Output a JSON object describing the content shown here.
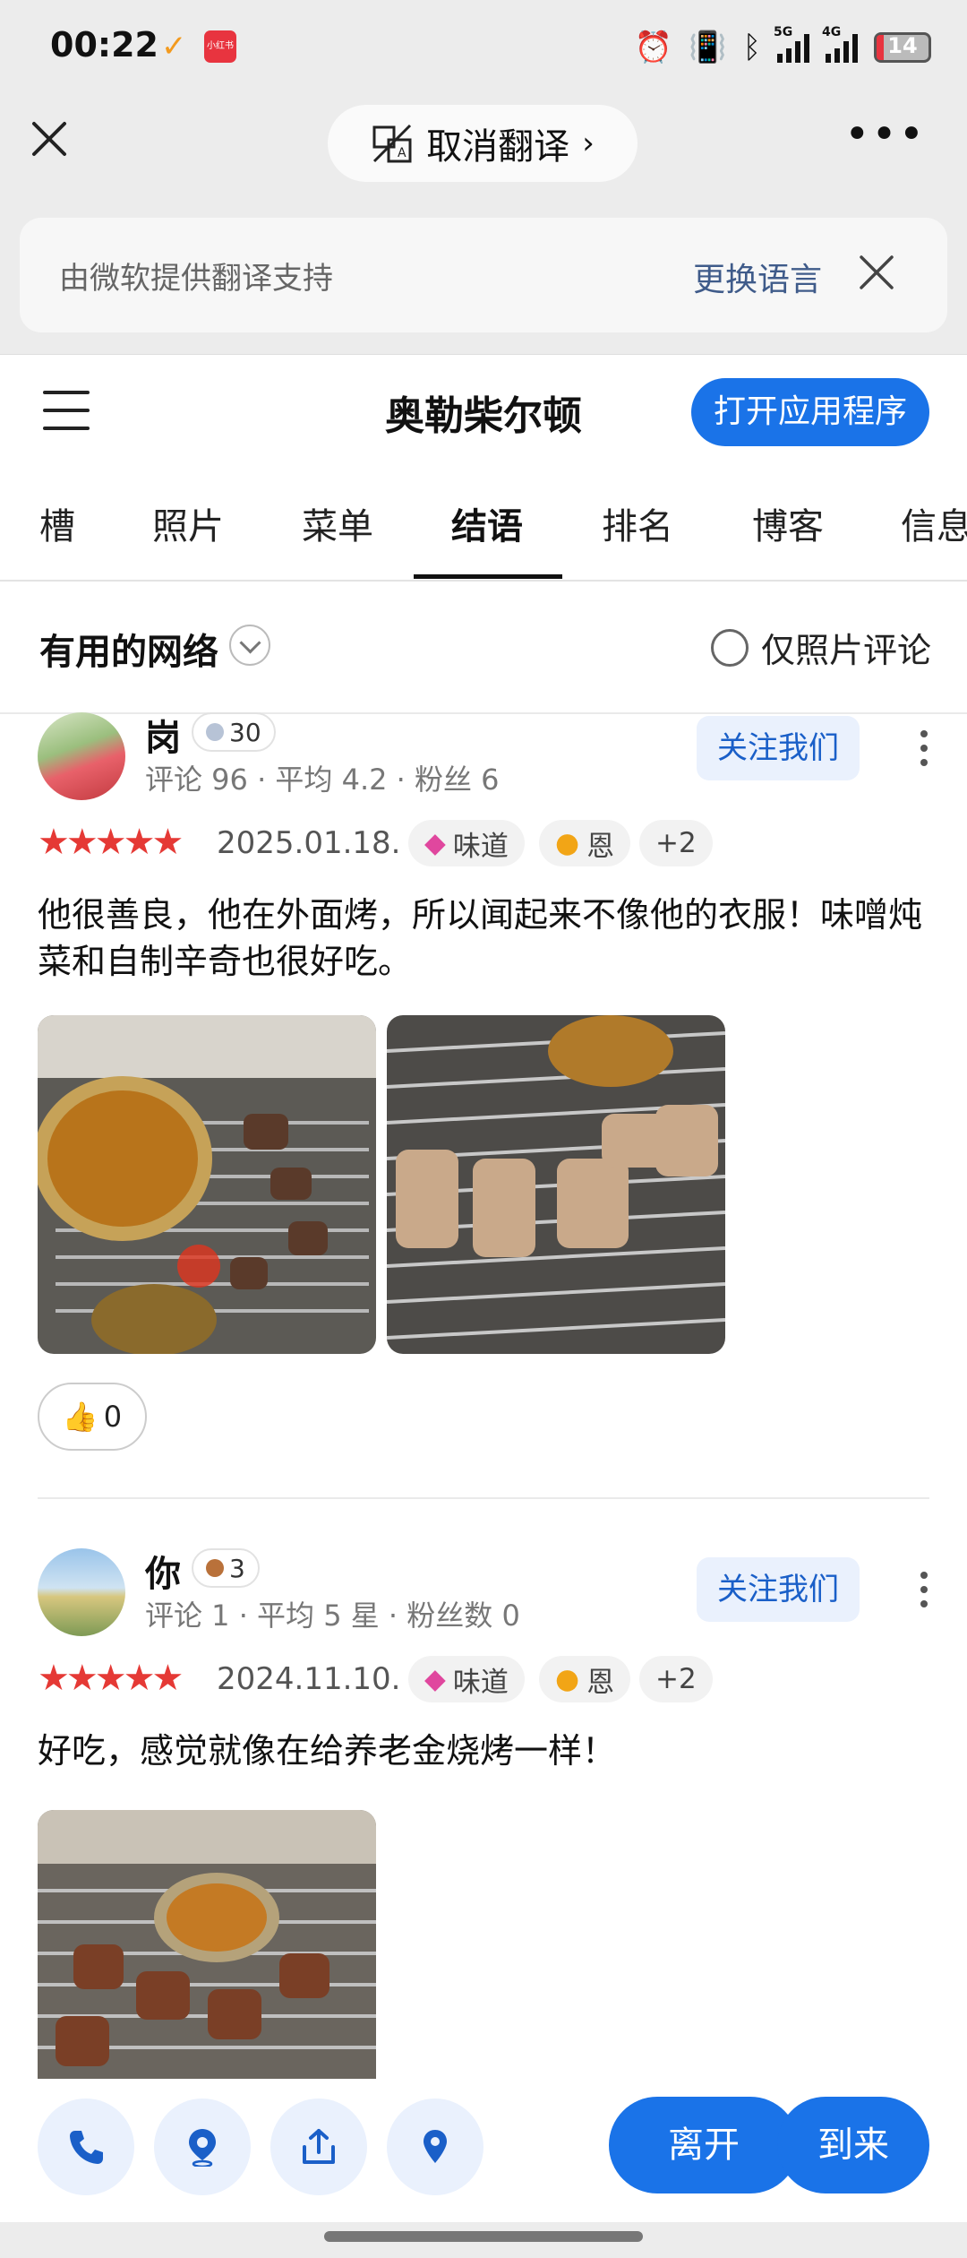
{
  "status_bar": {
    "time": "00:22",
    "mini_app_label": "小红书",
    "network_1": "5G",
    "network_2": "4G",
    "battery": "14"
  },
  "translate_bar": {
    "cancel_label": "取消翻译",
    "provider_text": "由微软提供翻译支持",
    "change_language": "更换语言"
  },
  "header": {
    "title": "奥勒柴尔顿",
    "open_app": "打开应用程序"
  },
  "tabs": [
    {
      "label": "槽"
    },
    {
      "label": "照片"
    },
    {
      "label": "菜单"
    },
    {
      "label": "结语",
      "active": true
    },
    {
      "label": "排名"
    },
    {
      "label": "博客"
    },
    {
      "label": "信息"
    }
  ],
  "filter": {
    "sort": "有用的网络",
    "photo_only": "仅照片评论"
  },
  "reviews": [
    {
      "name": "岗",
      "level": "30",
      "meta": "评论 96 · 平均 4.2 · 粉丝 6",
      "follow": "关注我们",
      "stars": "★★★★★",
      "date": "2025.01.18.",
      "chips": [
        "味道",
        "恩",
        "+2"
      ],
      "text": "他很善良，他在外面烤，所以闻起来不像他的衣服！味噌炖菜和自制辛奇也很好吃。",
      "likes": "0"
    },
    {
      "name": "你",
      "level": "3",
      "meta": "评论 1 · 平均 5 星 · 粉丝数 0",
      "follow": "关注我们",
      "stars": "★★★★★",
      "date": "2024.11.10.",
      "chips": [
        "味道",
        "恩",
        "+2"
      ],
      "text": "好吃，感觉就像在给养老金烧烤一样！"
    }
  ],
  "bottom_bar": {
    "leave": "离开",
    "arrive": "到来"
  },
  "colors": {
    "accent": "#1a73e8",
    "star": "#e53935",
    "follow_bg": "#eaf1fd"
  }
}
